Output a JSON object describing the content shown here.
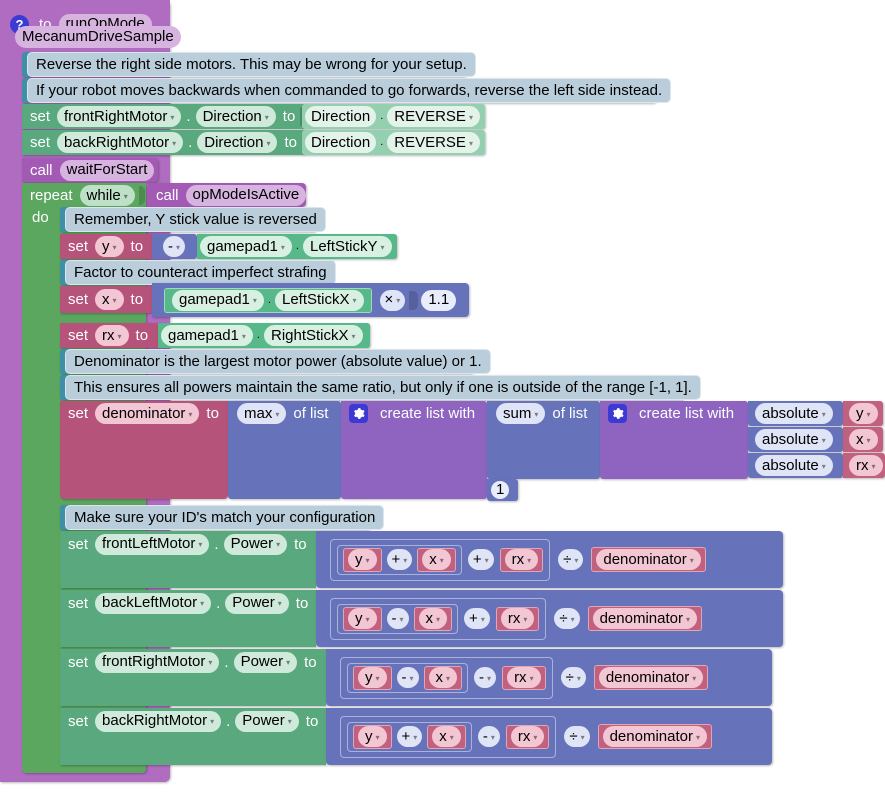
{
  "workspace": {
    "procedure": {
      "icon": "question-mark-icon",
      "to_label": "to",
      "name": "runOpMode",
      "subtitle": "MecanumDriveSample"
    },
    "comments": {
      "c1": "Reverse the right side motors.  This may be wrong for your setup.",
      "c2": "If your robot moves backwards when commanded to go forwards, reverse the left side instead.",
      "c3": "Remember, Y stick value is reversed",
      "c4": "Factor to counteract imperfect strafing",
      "c5": "Denominator is the largest motor power (absolute value) or 1.",
      "c6": "This ensures all powers maintain the same ratio, but only if one is outside of the range [-1, 1].",
      "c7": "Make sure your ID's match your configuration"
    },
    "keywords": {
      "set": "set",
      "to": "to",
      "call": "call",
      "repeat": "repeat",
      "do": "do",
      "dot": ".",
      "of_list": "of list",
      "create_list_with": "create list with"
    },
    "direction_rows": [
      {
        "set": "set",
        "motor": "frontRightMotor",
        "property": "Direction",
        "to": "to",
        "value_class": "Direction",
        "value_member": "REVERSE"
      },
      {
        "set": "set",
        "motor": "backRightMotor",
        "property": "Direction",
        "to": "to",
        "value_class": "Direction",
        "value_member": "REVERSE"
      }
    ],
    "wait_for_start": {
      "call": "call",
      "name": "waitForStart"
    },
    "loop": {
      "repeat": "repeat",
      "mode": "while",
      "call": "call",
      "condition": "opModeIsActive",
      "do": "do"
    },
    "assignments": {
      "y": {
        "set": "set",
        "var": "y",
        "to": "to",
        "negate": "-",
        "source_object": "gamepad1",
        "dot": ".",
        "source_member": "LeftStickY"
      },
      "x": {
        "set": "set",
        "var": "x",
        "to": "to",
        "source_object": "gamepad1",
        "dot": ".",
        "source_member": "LeftStickX",
        "operator": "×",
        "factor": "1.1"
      },
      "rx": {
        "set": "set",
        "var": "rx",
        "to": "to",
        "source_object": "gamepad1",
        "dot": ".",
        "source_member": "RightStickX"
      },
      "denominator": {
        "set": "set",
        "var": "denominator",
        "to": "to",
        "outer_fn": "max",
        "of_list": "of list",
        "create_list_with": "create list with",
        "inner_fn": "sum",
        "abs_label": "absolute",
        "abs_items": [
          "y",
          "x",
          "rx"
        ],
        "number_one": "1"
      }
    },
    "power_rows": [
      {
        "set": "set",
        "motor": "frontLeftMotor",
        "dot": ".",
        "property": "Power",
        "to": "to",
        "a": "y",
        "op1": "+",
        "b": "x",
        "op2": "+",
        "c": "rx",
        "div": "÷",
        "denominator": "denominator"
      },
      {
        "set": "set",
        "motor": "backLeftMotor",
        "dot": ".",
        "property": "Power",
        "to": "to",
        "a": "y",
        "op1": "-",
        "b": "x",
        "op2": "+",
        "c": "rx",
        "div": "÷",
        "denominator": "denominator"
      },
      {
        "set": "set",
        "motor": "frontRightMotor",
        "dot": ".",
        "property": "Power",
        "to": "to",
        "a": "y",
        "op1": "-",
        "b": "x",
        "op2": "-",
        "c": "rx",
        "div": "÷",
        "denominator": "denominator"
      },
      {
        "set": "set",
        "motor": "backRightMotor",
        "dot": ".",
        "property": "Power",
        "to": "to",
        "a": "y",
        "op1": "+",
        "b": "x",
        "op2": "-",
        "c": "rx",
        "div": "÷",
        "denominator": "denominator"
      }
    ],
    "colors": {
      "procedure": "#b06cc0",
      "control_loop": "#5ba75f",
      "setter_green": "#5aa97e",
      "comment_teal": "#3f8fa6",
      "variable_magenta": "#b5537a",
      "math_blue": "#6673bb",
      "list_purple": "#8f63c0",
      "background": "#ffffff"
    }
  }
}
